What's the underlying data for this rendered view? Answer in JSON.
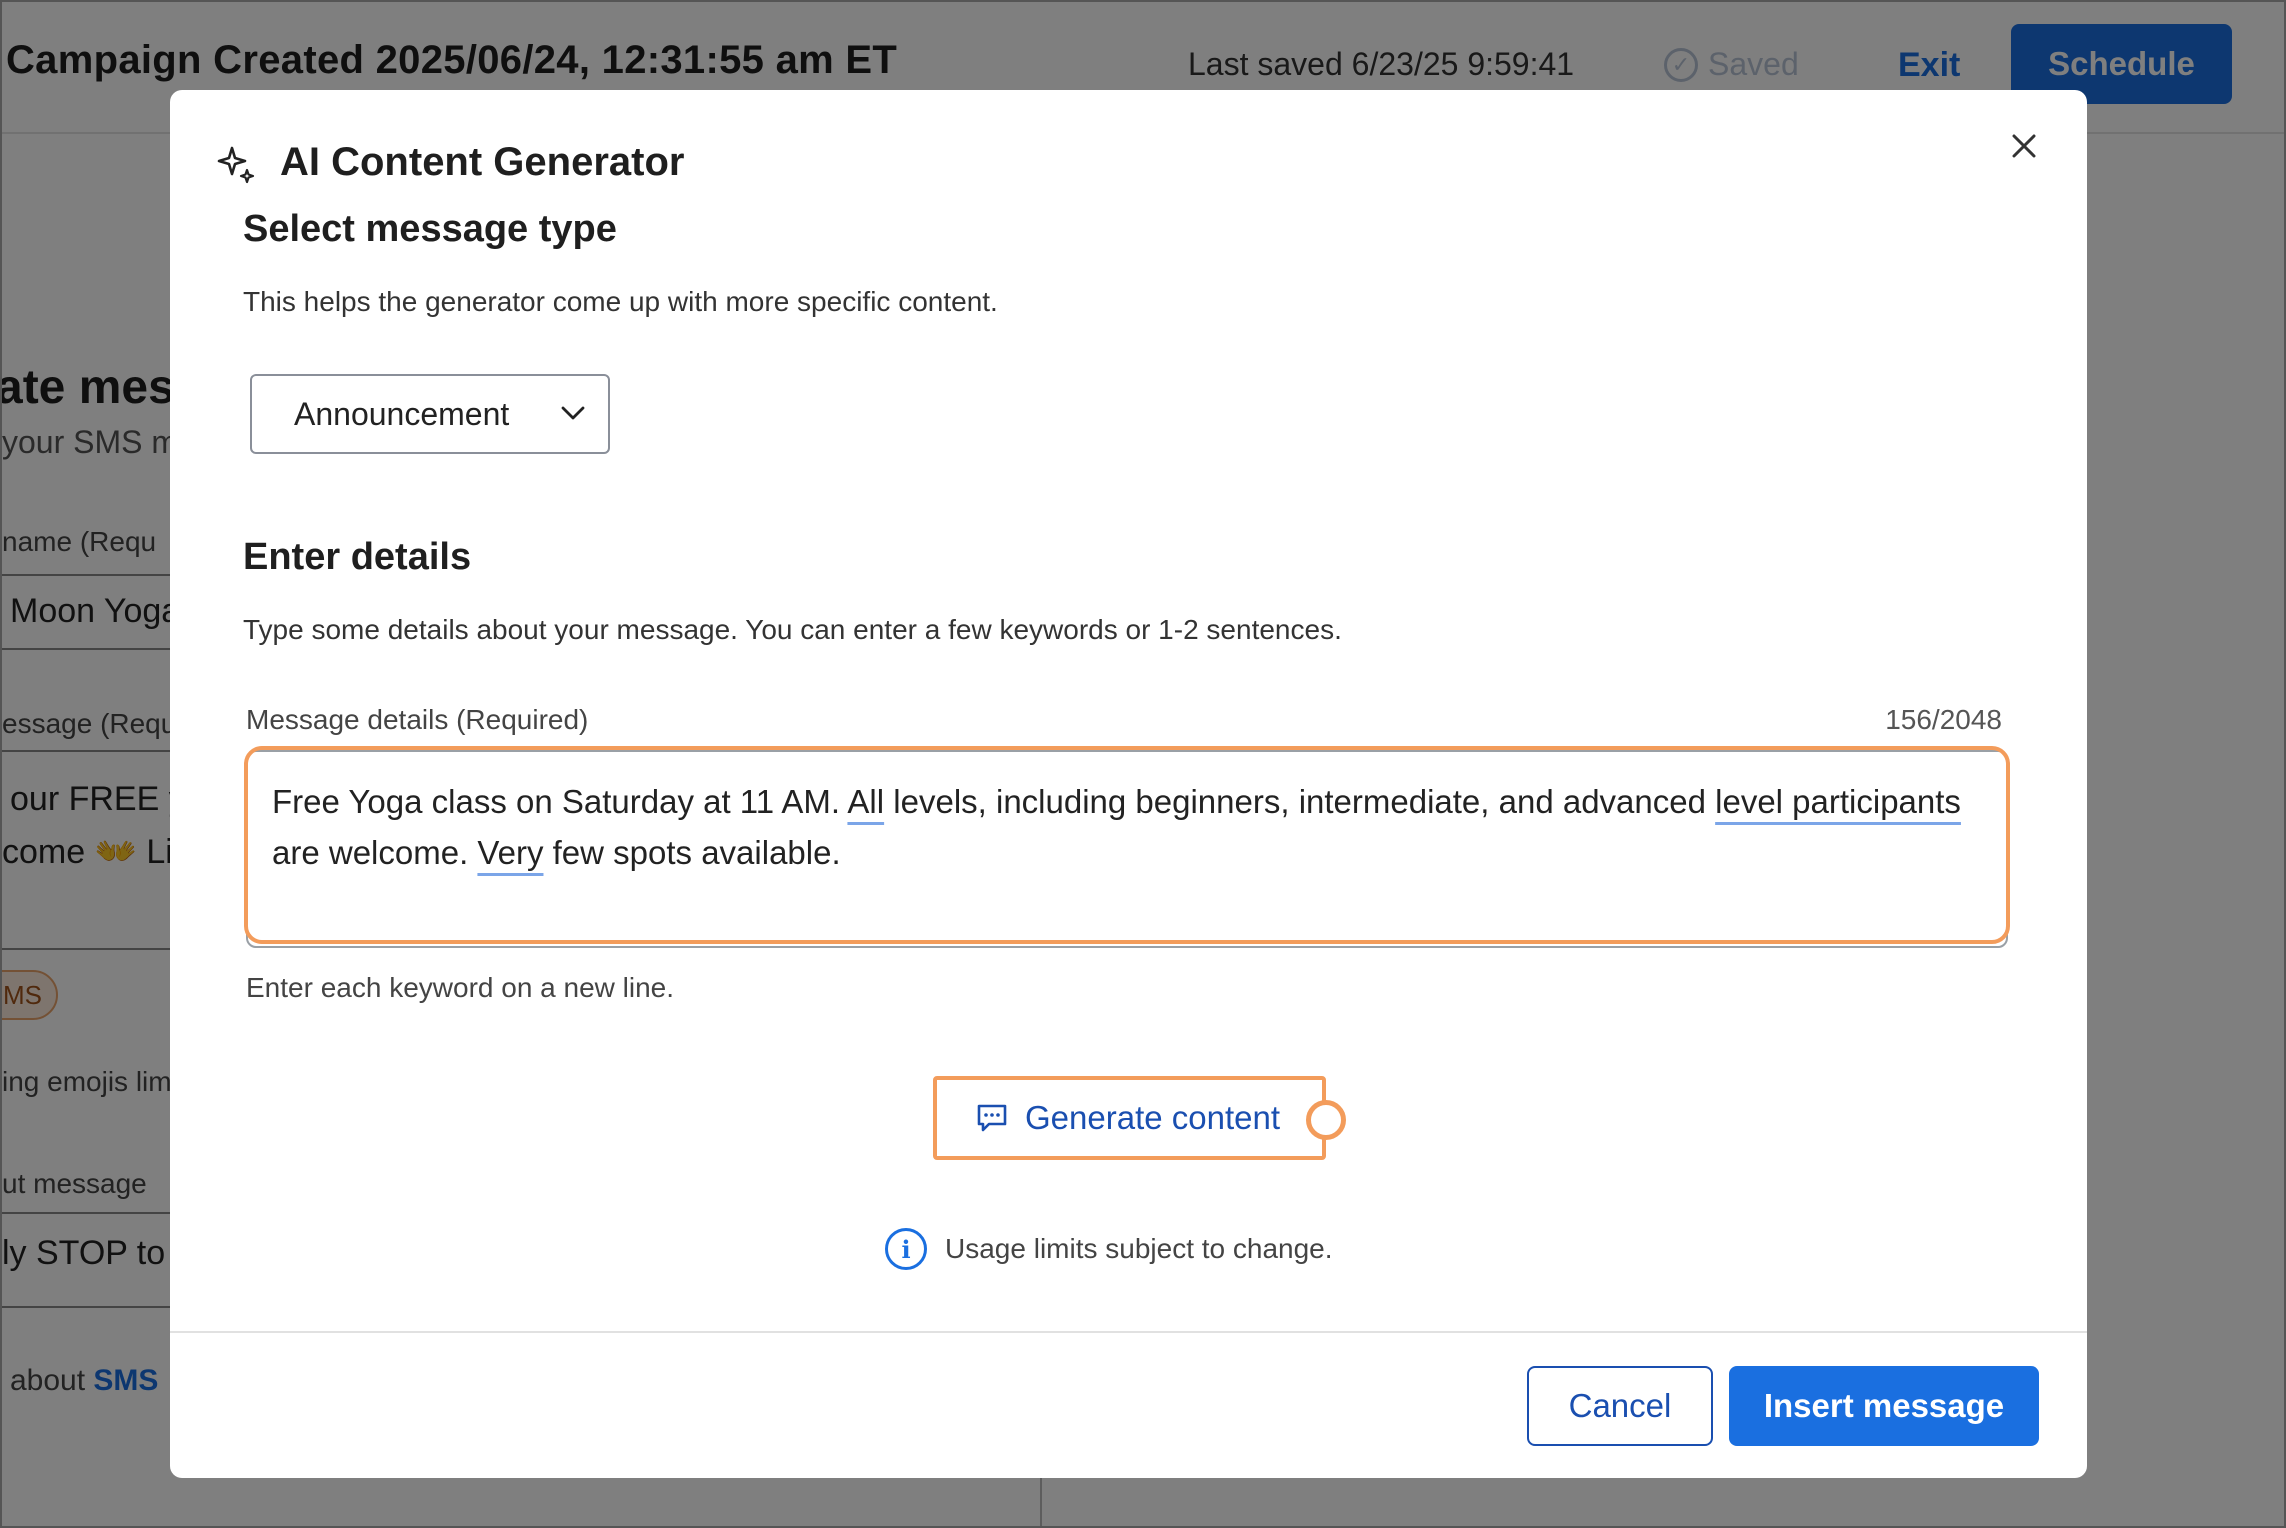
{
  "header": {
    "title": "Campaign Created 2025/06/24, 12:31:55 am ET",
    "last_saved": "Last saved 6/23/25 9:59:41",
    "saved_label": "Saved",
    "exit_label": "Exit",
    "schedule_label": "Schedule"
  },
  "background": {
    "heading_fragment": "ate mes",
    "subheading_fragment": "your SMS m",
    "field1_label_fragment": "name  (Requ",
    "field1_value_fragment": "Moon Yoga",
    "field2_label_fragment": "essage  (Requ",
    "field2_line1_fragment": "our FREE y",
    "field2_line2_fragment": "come 👐 Lim",
    "pill_fragment": "MS",
    "emoji_note_fragment": "ing emojis lim",
    "field3_label_fragment": "ut message",
    "field3_value_fragment": "ly STOP to u",
    "about_prefix": "about",
    "about_link": "SMS"
  },
  "modal": {
    "title": "AI Content Generator",
    "section_type": {
      "heading": "Select message type",
      "description": "This helps the generator come up with more specific content.",
      "selected": "Announcement"
    },
    "section_details": {
      "heading": "Enter details",
      "description": "Type some details about your message. You can enter a few keywords or 1-2 sentences.",
      "field_label": "Message details  (Required)",
      "char_count": "156/2048",
      "line1": {
        "a": "Free Yoga class on Saturday at 11 AM. ",
        "b": "All",
        "c": " levels, including beginners, intermediate, and advanced ",
        "d": "level participants"
      },
      "line2": {
        "a": "are welcome. ",
        "b": "Very",
        "c": " few spots available."
      },
      "hint": "Enter each keyword on a new line."
    },
    "generate_label": "Generate content",
    "usage_note": "Usage limits subject to change.",
    "cancel_label": "Cancel",
    "insert_label": "Insert message"
  },
  "colors": {
    "primary": "#1a6fe0",
    "highlight": "#f39c5b",
    "overlay": "rgba(0,0,0,0.5)"
  },
  "icons": [
    "sparkle-icon",
    "close-icon",
    "chevron-down-icon",
    "chat-icon",
    "info-icon",
    "check-circle-icon"
  ]
}
